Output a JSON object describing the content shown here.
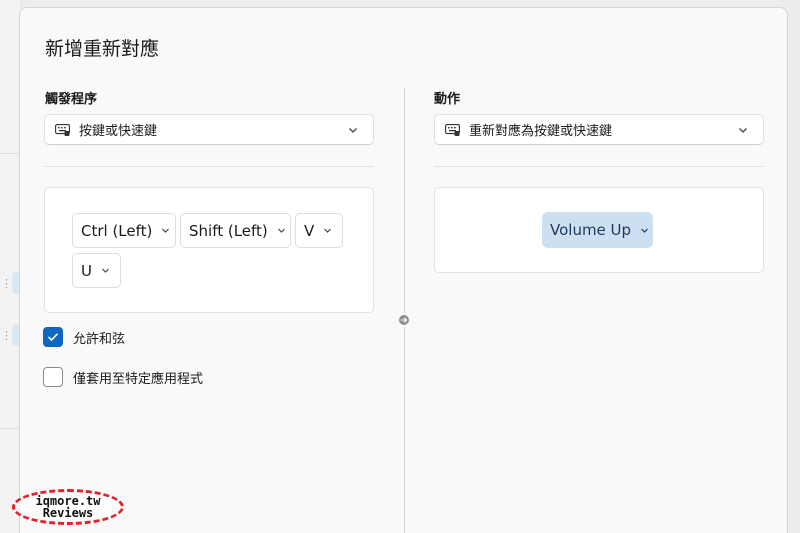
{
  "dialog": {
    "title": "新增重新對應"
  },
  "trigger": {
    "label": "觸發程序",
    "type_combo": {
      "value": "按鍵或快速鍵",
      "icon": "keyboard-icon"
    },
    "keys": [
      "Ctrl (Left)",
      "Shift (Left)",
      "V",
      "U"
    ],
    "checkboxes": [
      {
        "label": "允許和弦",
        "checked": true
      },
      {
        "label": "僅套用至特定應用程式",
        "checked": false
      }
    ]
  },
  "action": {
    "label": "動作",
    "type_combo": {
      "value": "重新對應為按鍵或快速鍵",
      "icon": "keyboard-icon"
    },
    "target_key": "Volume Up"
  },
  "watermark": {
    "line1": "iqmore.tw",
    "line2": "Reviews"
  },
  "colors": {
    "accent": "#0f67c0",
    "target_chip": "#cde0f1",
    "watermark_border": "#e0222a"
  }
}
